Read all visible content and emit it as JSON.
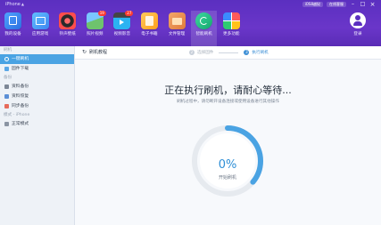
{
  "window": {
    "device": "iPhone",
    "device_arrow": "▲",
    "sys_badge_1": "iOS8越狱",
    "sys_badge_2": "在线客服"
  },
  "nav": {
    "items": [
      {
        "label": "我的设备",
        "icon": "device-icon",
        "badge": ""
      },
      {
        "label": "应用游戏",
        "icon": "apps-icon",
        "badge": ""
      },
      {
        "label": "铃声壁纸",
        "icon": "music-icon",
        "badge": ""
      },
      {
        "label": "照片视频",
        "icon": "photo-icon",
        "badge": "19"
      },
      {
        "label": "视频影音",
        "icon": "video-icon",
        "badge": "27"
      },
      {
        "label": "电子书籍",
        "icon": "ebook-icon",
        "badge": ""
      },
      {
        "label": "文件管理",
        "icon": "folder-icon",
        "badge": ""
      },
      {
        "label": "智能刷机",
        "icon": "flash-icon",
        "badge": ""
      },
      {
        "label": "更多功能",
        "icon": "more-icon",
        "badge": ""
      }
    ],
    "login_label": "登录",
    "active_index": 7
  },
  "sidebar": {
    "sections": [
      {
        "title": "刷机",
        "items": [
          {
            "label": "一键刷机",
            "icon": "flash-icon",
            "active": true
          },
          {
            "label": "固件下载",
            "icon": "download-icon",
            "active": false
          }
        ]
      },
      {
        "title": "备份",
        "items": [
          {
            "label": "资料备份",
            "icon": "phone-icon",
            "active": false
          },
          {
            "label": "资料恢复",
            "icon": "book-icon",
            "active": false
          },
          {
            "label": "同步备份",
            "icon": "sync-icon",
            "active": false
          }
        ]
      },
      {
        "title": "模式 - iPhone",
        "items": [
          {
            "label": "正常模式",
            "icon": "device-mode-icon",
            "active": false
          }
        ]
      }
    ]
  },
  "main": {
    "back_label": "刷机教程",
    "steps": [
      {
        "num": "2",
        "label": "选择固件",
        "active": false
      },
      {
        "num": "3",
        "label": "执行刷机",
        "active": true
      }
    ],
    "title": "正在执行刷机，请耐心等待...",
    "subtitle": "刷机过程中，请勿断开设备连接或使用设备进行其他操作",
    "progress_percent": 0,
    "progress_label": "0%",
    "status": "开始刷机",
    "accent": "#4aa3e3"
  }
}
